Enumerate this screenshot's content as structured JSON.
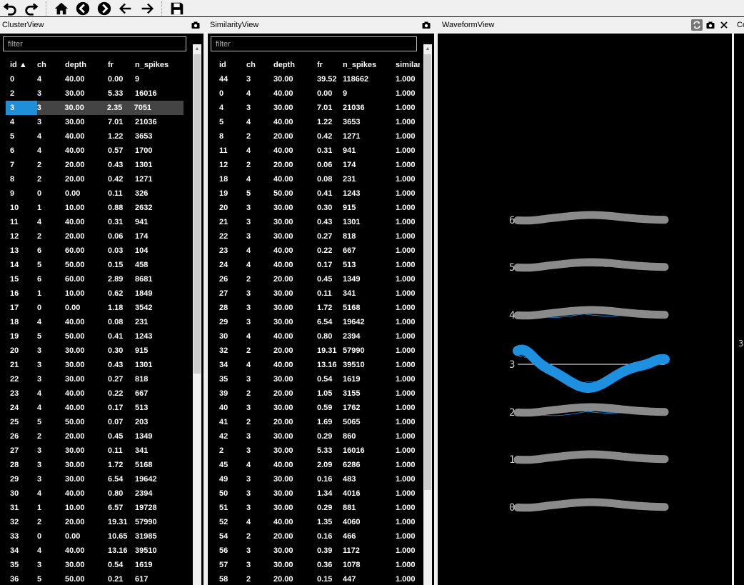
{
  "toolbar": {
    "buttons": [
      {
        "name": "undo-icon"
      },
      {
        "name": "redo-icon"
      },
      {
        "name": "home-icon"
      },
      {
        "name": "prev-circle-icon"
      },
      {
        "name": "next-circle-icon"
      },
      {
        "name": "arrow-left-icon"
      },
      {
        "name": "arrow-right-icon"
      },
      {
        "name": "save-icon"
      }
    ]
  },
  "cluster_view": {
    "title": "ClusterView",
    "filter_placeholder": "filter",
    "columns": [
      "id ▲",
      "ch",
      "depth",
      "fr",
      "n_spikes"
    ],
    "selected_index": 2,
    "rows": [
      [
        "0",
        "4",
        "40.00",
        "0.00",
        "9"
      ],
      [
        "2",
        "3",
        "30.00",
        "5.33",
        "16016"
      ],
      [
        "3",
        "3",
        "30.00",
        "2.35",
        "7051"
      ],
      [
        "4",
        "3",
        "30.00",
        "7.01",
        "21036"
      ],
      [
        "5",
        "4",
        "40.00",
        "1.22",
        "3653"
      ],
      [
        "6",
        "4",
        "40.00",
        "0.57",
        "1700"
      ],
      [
        "7",
        "2",
        "20.00",
        "0.43",
        "1301"
      ],
      [
        "8",
        "2",
        "20.00",
        "0.42",
        "1271"
      ],
      [
        "9",
        "0",
        "0.00",
        "0.11",
        "326"
      ],
      [
        "10",
        "1",
        "10.00",
        "0.88",
        "2632"
      ],
      [
        "11",
        "4",
        "40.00",
        "0.31",
        "941"
      ],
      [
        "12",
        "2",
        "20.00",
        "0.06",
        "174"
      ],
      [
        "13",
        "6",
        "60.00",
        "0.03",
        "104"
      ],
      [
        "14",
        "5",
        "50.00",
        "0.15",
        "458"
      ],
      [
        "15",
        "6",
        "60.00",
        "2.89",
        "8681"
      ],
      [
        "16",
        "1",
        "10.00",
        "0.62",
        "1849"
      ],
      [
        "17",
        "0",
        "0.00",
        "1.18",
        "3542"
      ],
      [
        "18",
        "4",
        "40.00",
        "0.08",
        "231"
      ],
      [
        "19",
        "5",
        "50.00",
        "0.41",
        "1243"
      ],
      [
        "20",
        "3",
        "30.00",
        "0.30",
        "915"
      ],
      [
        "21",
        "3",
        "30.00",
        "0.43",
        "1301"
      ],
      [
        "22",
        "3",
        "30.00",
        "0.27",
        "818"
      ],
      [
        "23",
        "4",
        "40.00",
        "0.22",
        "667"
      ],
      [
        "24",
        "4",
        "40.00",
        "0.17",
        "513"
      ],
      [
        "25",
        "5",
        "50.00",
        "0.07",
        "203"
      ],
      [
        "26",
        "2",
        "20.00",
        "0.45",
        "1349"
      ],
      [
        "27",
        "3",
        "30.00",
        "0.11",
        "341"
      ],
      [
        "28",
        "3",
        "30.00",
        "1.72",
        "5168"
      ],
      [
        "29",
        "3",
        "30.00",
        "6.54",
        "19642"
      ],
      [
        "30",
        "4",
        "40.00",
        "0.80",
        "2394"
      ],
      [
        "31",
        "1",
        "10.00",
        "6.57",
        "19728"
      ],
      [
        "32",
        "2",
        "20.00",
        "19.31",
        "57990"
      ],
      [
        "33",
        "0",
        "0.00",
        "10.65",
        "31985"
      ],
      [
        "34",
        "4",
        "40.00",
        "13.16",
        "39510"
      ],
      [
        "35",
        "3",
        "30.00",
        "0.54",
        "1619"
      ],
      [
        "36",
        "5",
        "50.00",
        "0.21",
        "617"
      ]
    ]
  },
  "similarity_view": {
    "title": "SimilarityView",
    "filter_placeholder": "filter",
    "columns": [
      "id",
      "ch",
      "depth",
      "fr",
      "n_spikes",
      "similari"
    ],
    "rows": [
      [
        "44",
        "3",
        "30.00",
        "39.52",
        "118662",
        "1.000"
      ],
      [
        "0",
        "4",
        "40.00",
        "0.00",
        "9",
        "1.000"
      ],
      [
        "4",
        "3",
        "30.00",
        "7.01",
        "21036",
        "1.000"
      ],
      [
        "5",
        "4",
        "40.00",
        "1.22",
        "3653",
        "1.000"
      ],
      [
        "8",
        "2",
        "20.00",
        "0.42",
        "1271",
        "1.000"
      ],
      [
        "11",
        "4",
        "40.00",
        "0.31",
        "941",
        "1.000"
      ],
      [
        "12",
        "2",
        "20.00",
        "0.06",
        "174",
        "1.000"
      ],
      [
        "18",
        "4",
        "40.00",
        "0.08",
        "231",
        "1.000"
      ],
      [
        "19",
        "5",
        "50.00",
        "0.41",
        "1243",
        "1.000"
      ],
      [
        "20",
        "3",
        "30.00",
        "0.30",
        "915",
        "1.000"
      ],
      [
        "21",
        "3",
        "30.00",
        "0.43",
        "1301",
        "1.000"
      ],
      [
        "22",
        "3",
        "30.00",
        "0.27",
        "818",
        "1.000"
      ],
      [
        "23",
        "4",
        "40.00",
        "0.22",
        "667",
        "1.000"
      ],
      [
        "24",
        "4",
        "40.00",
        "0.17",
        "513",
        "1.000"
      ],
      [
        "26",
        "2",
        "20.00",
        "0.45",
        "1349",
        "1.000"
      ],
      [
        "27",
        "3",
        "30.00",
        "0.11",
        "341",
        "1.000"
      ],
      [
        "28",
        "3",
        "30.00",
        "1.72",
        "5168",
        "1.000"
      ],
      [
        "29",
        "3",
        "30.00",
        "6.54",
        "19642",
        "1.000"
      ],
      [
        "30",
        "4",
        "40.00",
        "0.80",
        "2394",
        "1.000"
      ],
      [
        "32",
        "2",
        "20.00",
        "19.31",
        "57990",
        "1.000"
      ],
      [
        "34",
        "4",
        "40.00",
        "13.16",
        "39510",
        "1.000"
      ],
      [
        "35",
        "3",
        "30.00",
        "0.54",
        "1619",
        "1.000"
      ],
      [
        "39",
        "2",
        "20.00",
        "1.05",
        "3155",
        "1.000"
      ],
      [
        "40",
        "3",
        "30.00",
        "0.59",
        "1762",
        "1.000"
      ],
      [
        "41",
        "2",
        "20.00",
        "1.69",
        "5065",
        "1.000"
      ],
      [
        "42",
        "3",
        "30.00",
        "0.29",
        "860",
        "1.000"
      ],
      [
        "2",
        "3",
        "30.00",
        "5.33",
        "16016",
        "1.000"
      ],
      [
        "45",
        "4",
        "40.00",
        "2.09",
        "6286",
        "1.000"
      ],
      [
        "49",
        "3",
        "30.00",
        "0.16",
        "483",
        "1.000"
      ],
      [
        "50",
        "3",
        "30.00",
        "1.34",
        "4016",
        "1.000"
      ],
      [
        "51",
        "3",
        "30.00",
        "0.29",
        "881",
        "1.000"
      ],
      [
        "52",
        "4",
        "40.00",
        "1.35",
        "4060",
        "1.000"
      ],
      [
        "54",
        "2",
        "20.00",
        "0.16",
        "466",
        "1.000"
      ],
      [
        "56",
        "3",
        "30.00",
        "0.39",
        "1172",
        "1.000"
      ],
      [
        "57",
        "3",
        "30.00",
        "0.36",
        "1078",
        "1.000"
      ],
      [
        "58",
        "2",
        "20.00",
        "0.15",
        "447",
        "1.000"
      ]
    ]
  },
  "waveform_view": {
    "title": "WaveformView",
    "channel_labels": [
      "6",
      "5",
      "4",
      "3",
      "2",
      "1",
      "0"
    ],
    "selected_channel": "3",
    "colors": {
      "background": "#000000",
      "mean_waveform": "#8a8a8a",
      "selected_waveform": "#1e90e0",
      "baseline": "#ffffff"
    }
  },
  "right_view": {
    "title_fragment": "Co",
    "label_fragment": "3"
  }
}
